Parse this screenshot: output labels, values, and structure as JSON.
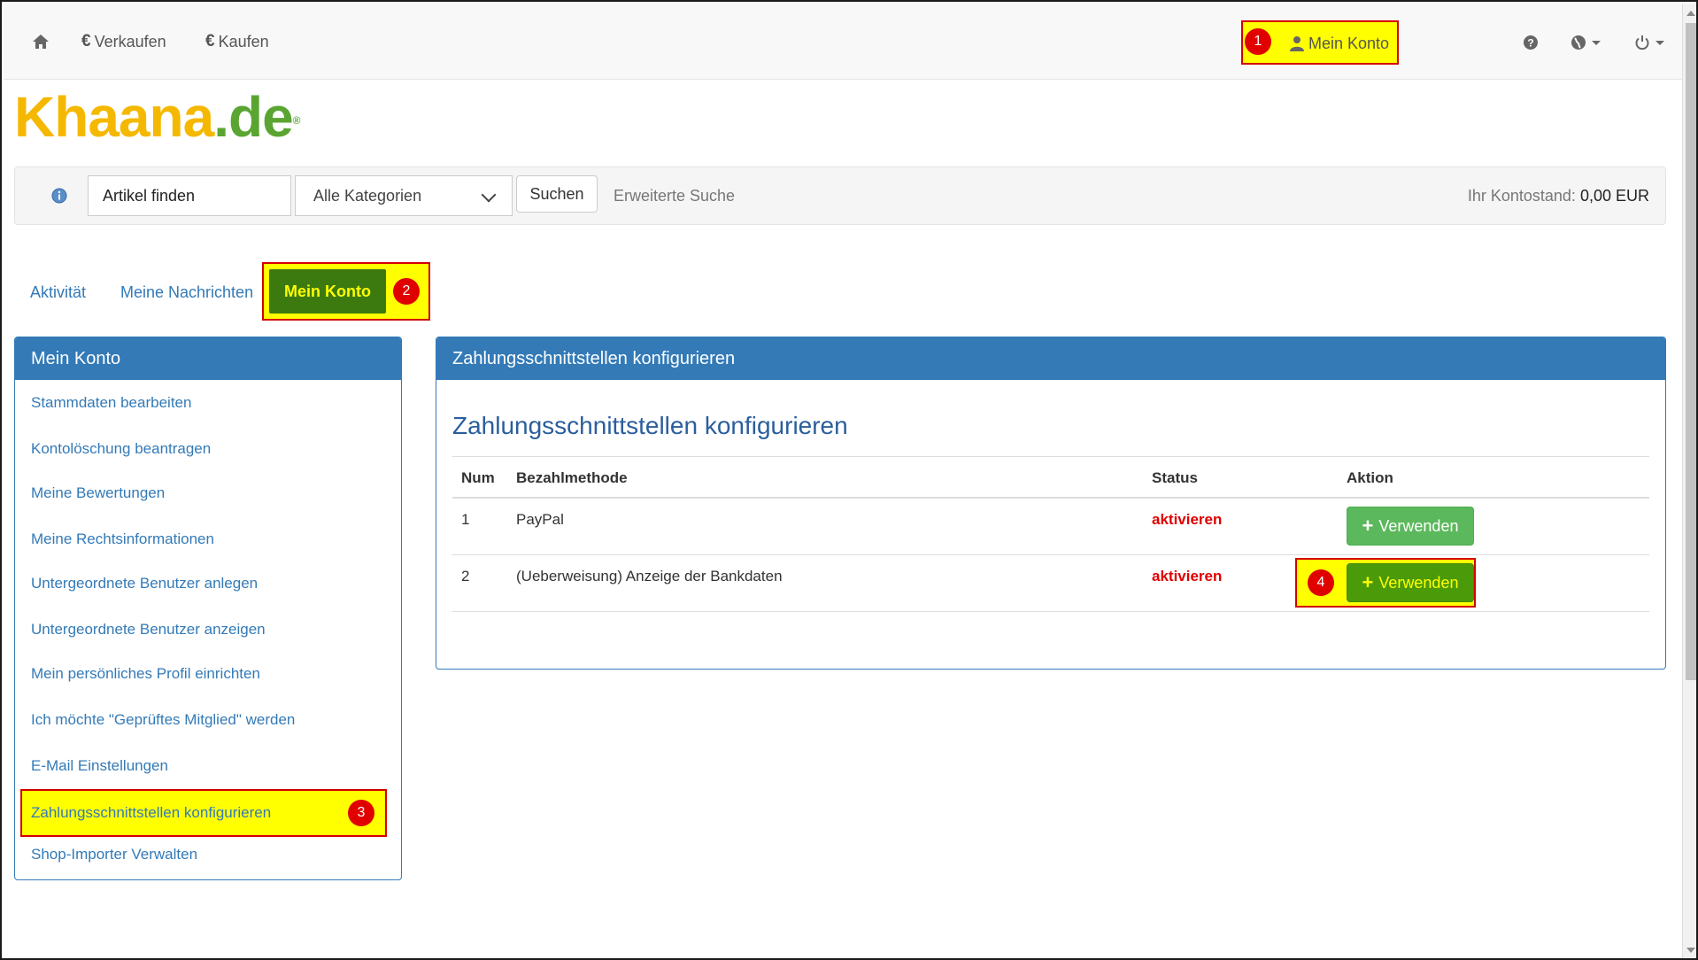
{
  "topnav": {
    "sell_label": "Verkaufen",
    "buy_label": "Kaufen",
    "account_label": "Mein Konto",
    "account_badge": "1"
  },
  "logo": {
    "part1": "Khaana",
    "part2": ".de",
    "reg": "®"
  },
  "search": {
    "input_value": "Artikel finden",
    "category": "Alle Kategorien",
    "search_button": "Suchen",
    "advanced": "Erweiterte Suche",
    "balance_label": "Ihr Kontostand:",
    "balance_value": "0,00 EUR"
  },
  "tabs": {
    "activity": "Aktivität",
    "messages": "Meine Nachrichten",
    "account": "Mein Konto",
    "account_badge": "2"
  },
  "sidebar": {
    "title": "Mein Konto",
    "items": [
      {
        "label": "Stammdaten bearbeiten"
      },
      {
        "label": "Kontolöschung beantragen"
      },
      {
        "label": "Meine Bewertungen"
      },
      {
        "label": "Meine Rechtsinformationen"
      },
      {
        "label": "Untergeordnete Benutzer anlegen"
      },
      {
        "label": "Untergeordnete Benutzer anzeigen"
      },
      {
        "label": "Mein persönliches Profil einrichten"
      },
      {
        "label": "Ich möchte \"Geprüftes Mitglied\" werden"
      },
      {
        "label": "E-Mail Einstellungen"
      },
      {
        "label": "Zahlungsschnittstellen konfigurieren"
      },
      {
        "label": "Shop-Importer Verwalten"
      }
    ],
    "active_badge": "3"
  },
  "main": {
    "panel_title": "Zahlungsschnittstellen konfigurieren",
    "heading": "Zahlungsschnittstellen konfigurieren",
    "columns": [
      "Num",
      "Bezahlmethode",
      "Status",
      "Aktion"
    ],
    "rows": [
      {
        "num": "1",
        "method": "PayPal",
        "status": "aktivieren",
        "action": "Verwenden"
      },
      {
        "num": "2",
        "method": "(Ueberweisung) Anzeige der Bankdaten",
        "status": "aktivieren",
        "action": "Verwenden"
      }
    ],
    "action_badge": "4"
  },
  "colors": {
    "highlight": "#ffff00",
    "highlight_border": "#d40000",
    "primary": "#337ab7",
    "success": "#5cb85c",
    "status_red": "#e00000"
  }
}
